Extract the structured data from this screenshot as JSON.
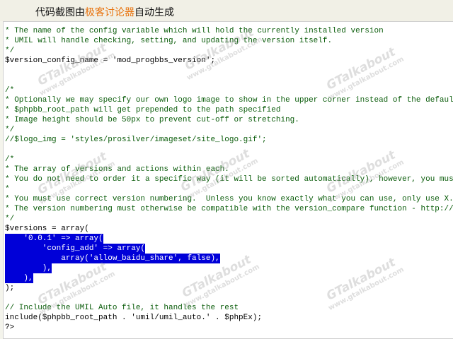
{
  "banner": {
    "prefix": "代码截图由",
    "highlight": "极客讨论器",
    "suffix": "自动生成",
    "highlight_color": "#e8720c"
  },
  "watermark": {
    "big": "GTalkabout",
    "small": "www.gtalkabout.com"
  },
  "code_lines": [
    "*",
    "* The name of the config variable which will hold the currently installed version",
    "* UMIL will handle checking, setting, and updating the version itself.",
    "*/",
    "$version_config_name = 'mod_progbbs_version';",
    "",
    "",
    "/*",
    "* Optionally we may specify our own logo image to show in the upper corner instead of the default logo.",
    "* $phpbb_root_path will get prepended to the path specified",
    "* Image height should be 50px to prevent cut-off or stretching.",
    "*/",
    "//$logo_img = 'styles/prosilver/imageset/site_logo.gif';",
    "",
    "/*",
    "* The array of versions and actions within each.",
    "* You do not need to order it a specific way (it will be sorted automatically), however, you must",
    "*",
    "* You must use correct version numbering.  Unless you know exactly what you can use, only use X.X.X",
    "* The version numbering must otherwise be compatible with the version_compare function - http://php",
    "*/",
    "$versions = array(",
    "    '0.0.1' => array(",
    "        'config_add' => array(",
    "            array('allow_baidu_share', false),",
    "        ),",
    "    ),",
    ");",
    "",
    "// Include the UMIL Auto file, it handles the rest",
    "include($phpbb_root_path . 'umil/umil_auto.' . $phpEx);",
    "?>"
  ]
}
